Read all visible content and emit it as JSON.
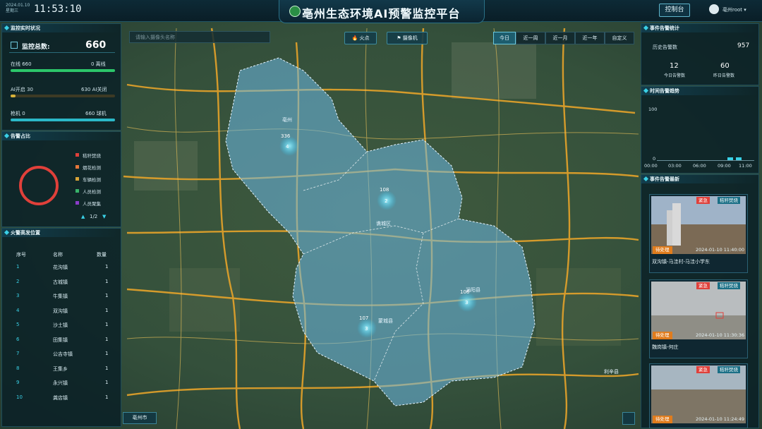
{
  "header": {
    "date": "2024.01.10",
    "weekday": "星期三",
    "time": "11:53:10",
    "title": "亳州生态环境AI预警监控平台",
    "console_label": "控制台",
    "user_name": "亳州root"
  },
  "monitor_status": {
    "title": "监控实时状况",
    "total_label": "监控总数:",
    "total_value": "660",
    "online_label": "在线 660",
    "offline_label": "0 离线",
    "online_fraction": 1.0,
    "ai_on_label": "AI开启 30",
    "ai_off_label": "630 AI关闭",
    "ai_fraction": 0.045,
    "gun_label": "枪机 0",
    "ball_label": "660 球机",
    "gun_fraction": 0.0
  },
  "alarm_share": {
    "title": "告警占比",
    "legend": [
      {
        "label": "秸秆焚烧",
        "color": "#e0403a"
      },
      {
        "label": "烟花检测",
        "color": "#e6773a"
      },
      {
        "label": "车辆检测",
        "color": "#d9a437"
      },
      {
        "label": "人员检测",
        "color": "#38b36a"
      },
      {
        "label": "人员聚集",
        "color": "#8a3cc9"
      }
    ],
    "page": "1/2"
  },
  "fire_table": {
    "title": "火警高发位置",
    "headers": [
      "序号",
      "名称",
      "数量"
    ],
    "rows": [
      [
        "1",
        "花沟镇",
        "1"
      ],
      [
        "2",
        "古城镇",
        "1"
      ],
      [
        "3",
        "牛集镇",
        "1"
      ],
      [
        "4",
        "双沟镇",
        "1"
      ],
      [
        "5",
        "沙土镇",
        "1"
      ],
      [
        "6",
        "田集镇",
        "1"
      ],
      [
        "7",
        "公吉寺镇",
        "1"
      ],
      [
        "8",
        "王集乡",
        "1"
      ],
      [
        "9",
        "永兴镇",
        "1"
      ],
      [
        "10",
        "龚店镇",
        "1"
      ]
    ]
  },
  "map": {
    "search_placeholder": "请输入摄像头名称",
    "toggle_fire": "火点",
    "toggle_camera": "摄像机",
    "ranges": [
      "今日",
      "近一周",
      "近一月",
      "近一年",
      "自定义"
    ],
    "active_range": "今日",
    "city_button": "亳州市",
    "markers": [
      {
        "flag": "336",
        "count": "4"
      },
      {
        "flag": "108",
        "count": "2"
      },
      {
        "flag": "108",
        "count": "3"
      },
      {
        "flag": "107",
        "count": "3"
      }
    ],
    "place_labels": [
      "亳州",
      "谯城区",
      "涡阳县",
      "蒙城县",
      "利辛县",
      "亳州市"
    ]
  },
  "event_stats": {
    "title": "事件告警统计",
    "history_label": "历史告警数",
    "history_value": "957",
    "today_pending_value": "12",
    "today_pending_label": "今日告警数",
    "daily_value": "60",
    "daily_label": "昨日告警数"
  },
  "trend": {
    "title": "时间告警趋势",
    "y_max": "100",
    "y_min": "0",
    "x_ticks": [
      "00:00",
      "03:00",
      "06:00",
      "09:00",
      "11:00"
    ]
  },
  "event_cards": {
    "title": "事件告警最新",
    "items": [
      {
        "level": "紧急",
        "type": "秸秆焚烧",
        "status": "待处理",
        "time": "2024-01-10 11:40:00",
        "location": "双沟镇-马洼村-马洼小学东"
      },
      {
        "level": "紧急",
        "type": "秸秆焚烧",
        "status": "待处理",
        "time": "2024-01-10 11:30:36",
        "location": "魏岗镇-何庄"
      },
      {
        "level": "紧急",
        "type": "秸秆焚烧",
        "status": "待处理",
        "time": "2024-01-10 11:24:49",
        "location": ""
      }
    ]
  },
  "colors": {
    "accent": "#3ad0e6",
    "online_bar": "#2cc66a",
    "ai_bar": "#d8b23a",
    "gun_bar": "#2bb8c8",
    "alert": "#e0403a",
    "pending": "#e07c1d"
  }
}
